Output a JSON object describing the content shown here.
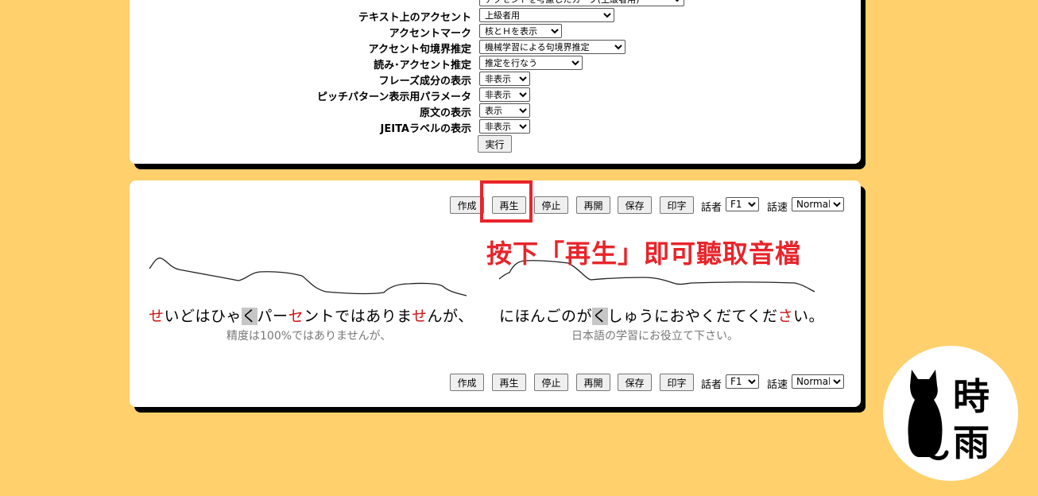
{
  "settings": {
    "rows": [
      {
        "label": "",
        "value": "アクセントを考慮したカーブ(上級者用)"
      },
      {
        "label": "テキスト上のアクセント",
        "value": "上級者用"
      },
      {
        "label": "アクセントマーク",
        "value": "核とＨを表示"
      },
      {
        "label": "アクセント句境界推定",
        "value": "機械学習による句境界推定"
      },
      {
        "label": "読み･アクセント推定",
        "value": "推定を行なう"
      },
      {
        "label": "フレーズ成分の表示",
        "value": "非表示"
      },
      {
        "label": "ピッチパターン表示用パラメータ",
        "value": "非表示"
      },
      {
        "label": "原文の表示",
        "value": "表示"
      },
      {
        "label": "JEITAラベルの表示",
        "value": "非表示"
      }
    ],
    "execute_label": "実行"
  },
  "toolbar": {
    "create_label": "作成",
    "play_label": "再生",
    "stop_label": "停止",
    "resume_label": "再開",
    "save_label": "保存",
    "print_label": "印字",
    "speaker_label": "話者",
    "speaker_value": "F1",
    "speed_label": "話速",
    "speed_value": "Normal"
  },
  "annotation": {
    "text": "按下「再生」即可聽取音檔",
    "color": "#E8242A"
  },
  "phrases": [
    {
      "segments": [
        {
          "t": "せ",
          "s": "acc"
        },
        {
          "t": "いどはひゃ",
          "s": ""
        },
        {
          "t": "く",
          "s": "hi"
        },
        {
          "t": "パー",
          "s": ""
        },
        {
          "t": "セ",
          "s": "acc"
        },
        {
          "t": "ントではあり",
          "s": ""
        },
        {
          "t": "ま",
          "s": ""
        },
        {
          "t": "せ",
          "s": "acc"
        },
        {
          "t": "んが、",
          "s": ""
        }
      ],
      "translation": "精度は100%ではありませんが、"
    },
    {
      "segments": [
        {
          "t": "にほんごのが",
          "s": ""
        },
        {
          "t": "く",
          "s": "hi"
        },
        {
          "t": "しゅうにおやくだてくだ",
          "s": ""
        },
        {
          "t": "さ",
          "s": "acc"
        },
        {
          "t": "い。",
          "s": ""
        }
      ],
      "translation": "日本語の学習にお役立て下さい。"
    }
  ],
  "logo": {
    "chars": [
      "時",
      "雨"
    ],
    "icon": "cat-silhouette-icon"
  },
  "colors": {
    "background": "#FFD06B",
    "accent_red": "#D01414",
    "highlight_red": "#E8242A"
  }
}
